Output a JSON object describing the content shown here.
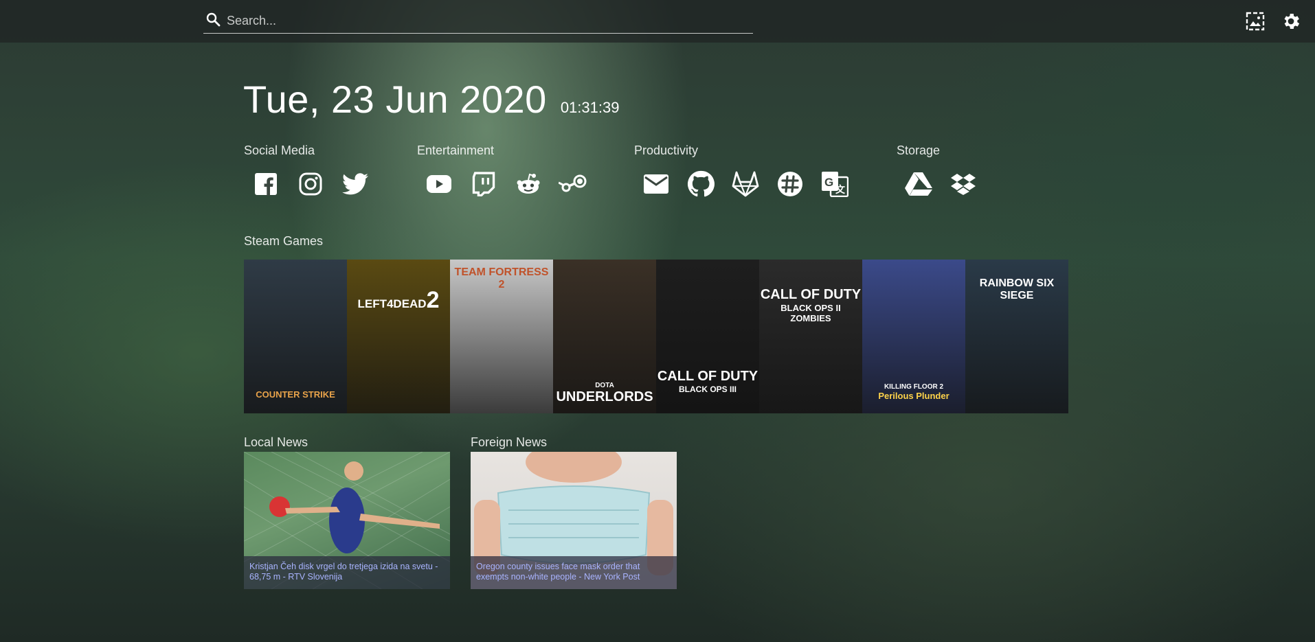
{
  "search": {
    "placeholder": "Search..."
  },
  "topbar": {
    "icons": [
      "wallpaper-icon",
      "gear-icon"
    ]
  },
  "clock": {
    "date": "Tue, 23 Jun 2020",
    "time": "01:31:39"
  },
  "groups": [
    {
      "title": "Social Media",
      "links": [
        "facebook-icon",
        "instagram-icon",
        "twitter-icon"
      ]
    },
    {
      "title": "Entertainment",
      "links": [
        "youtube-icon",
        "twitch-icon",
        "reddit-icon",
        "steam-icon"
      ]
    },
    {
      "title": "Productivity",
      "links": [
        "mail-icon",
        "github-icon",
        "gitlab-icon",
        "slack-icon",
        "google-translate-icon"
      ]
    },
    {
      "title": "Storage",
      "links": [
        "google-drive-icon",
        "dropbox-icon"
      ]
    }
  ],
  "steam": {
    "title": "Steam Games",
    "games": [
      {
        "line1": "COUNTER",
        "line2": "STRIKE",
        "color": "#2f3b46"
      },
      {
        "line1": "LEFT4DEAD",
        "line2": "2",
        "color": "#5a4a12"
      },
      {
        "line1": "TEAM FORTRESS",
        "line2": "2",
        "color": "#c8c8c8"
      },
      {
        "line1": "DOTA",
        "line2": "UNDERLORDS",
        "color": "#3a3026"
      },
      {
        "line1": "CALL OF DUTY",
        "line2": "BLACK OPS III",
        "color": "#1e1e1e"
      },
      {
        "line1": "CALL OF DUTY",
        "line2": "BLACK OPS II ZOMBIES",
        "color": "#2b2b2b"
      },
      {
        "line1": "KILLING FLOOR 2",
        "line2": "Perilous Plunder",
        "color": "#3b4a8a"
      },
      {
        "line1": "RAINBOW SIX",
        "line2": "SIEGE",
        "color": "#2a3a48"
      }
    ]
  },
  "news": [
    {
      "title": "Local News",
      "caption": "Kristjan Čeh disk vrgel do tretjega izida na svetu - 68,75 m - RTV Slovenija"
    },
    {
      "title": "Foreign News",
      "caption": "Oregon county issues face mask order that exempts non-white people - New York Post"
    }
  ]
}
